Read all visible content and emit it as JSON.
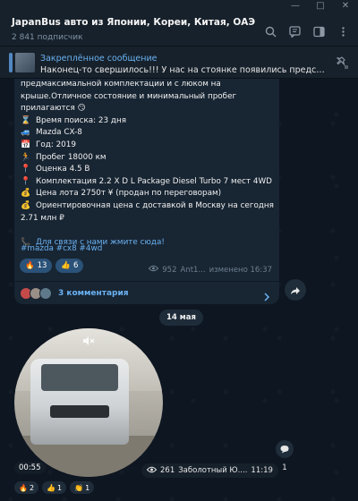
{
  "window": {
    "controls": [
      "—",
      "□",
      "✕"
    ]
  },
  "header": {
    "title": "JapanBus авто из Японии, Кореи, Китая, ОАЭ",
    "subscribers": "2 841 подписчик",
    "icons": [
      "search-icon",
      "comments-icon",
      "sidebar-icon",
      "more-icon"
    ]
  },
  "pinned": {
    "title": "Закреплённое сообщение",
    "text": "Наконец-то свершилось!!! У нас на стоянке появились представители К..."
  },
  "message": {
    "intro_lines": [
      "предмаксимальной комплектации и с люком на",
      "крыше.Отличное состояние и минимальный пробег",
      "прилагаются 😏"
    ],
    "details": [
      {
        "icon": "⌛",
        "text": "Время поиска: 23 дня"
      },
      {
        "icon": "🚙",
        "text": "Mazda CX-8"
      },
      {
        "icon": "📅",
        "text": "Год: 2019"
      },
      {
        "icon": "🏃",
        "text": "Пробег 18000 км"
      },
      {
        "icon": "📍",
        "text": "Оценка 4.5 В"
      },
      {
        "icon": "📍",
        "text": "Комплектация 2.2 X D L Package Diesel Turbo 7 мест 4WD"
      },
      {
        "icon": "💰",
        "text": "Цена лота 2750т ¥ (продан по переговорам)"
      },
      {
        "icon": "💰",
        "text": "Ориентировочная цена с доставкой в Москву на сегодня"
      }
    ],
    "price_line": "2.71 млн ₽",
    "contact_icon": "📞",
    "contact_link": "Для связи с нами жмите сюда!",
    "hashtags": "#mazda #cx8 #4wd",
    "reactions": [
      {
        "emoji": "🔥",
        "count": "13"
      },
      {
        "emoji": "👍",
        "count": "6"
      }
    ],
    "views": "952",
    "author": "Ant1...",
    "edited": "изменено 16:37",
    "comments_label": "3 комментария"
  },
  "date_separator": "14 мая",
  "video": {
    "duration": "00:55",
    "views": "261",
    "author": "Заболотный Ю....",
    "time": "11:19",
    "comments_count": "1",
    "reactions": [
      {
        "emoji": "🔥",
        "count": "2"
      },
      {
        "emoji": "👍",
        "count": "1"
      },
      {
        "emoji": "👏",
        "count": "1"
      }
    ]
  },
  "colors": {
    "background": "#0e1621",
    "header": "#17212b",
    "bubble": "#182533",
    "accent": "#6ab2f2",
    "reaction": "#2b5278"
  }
}
